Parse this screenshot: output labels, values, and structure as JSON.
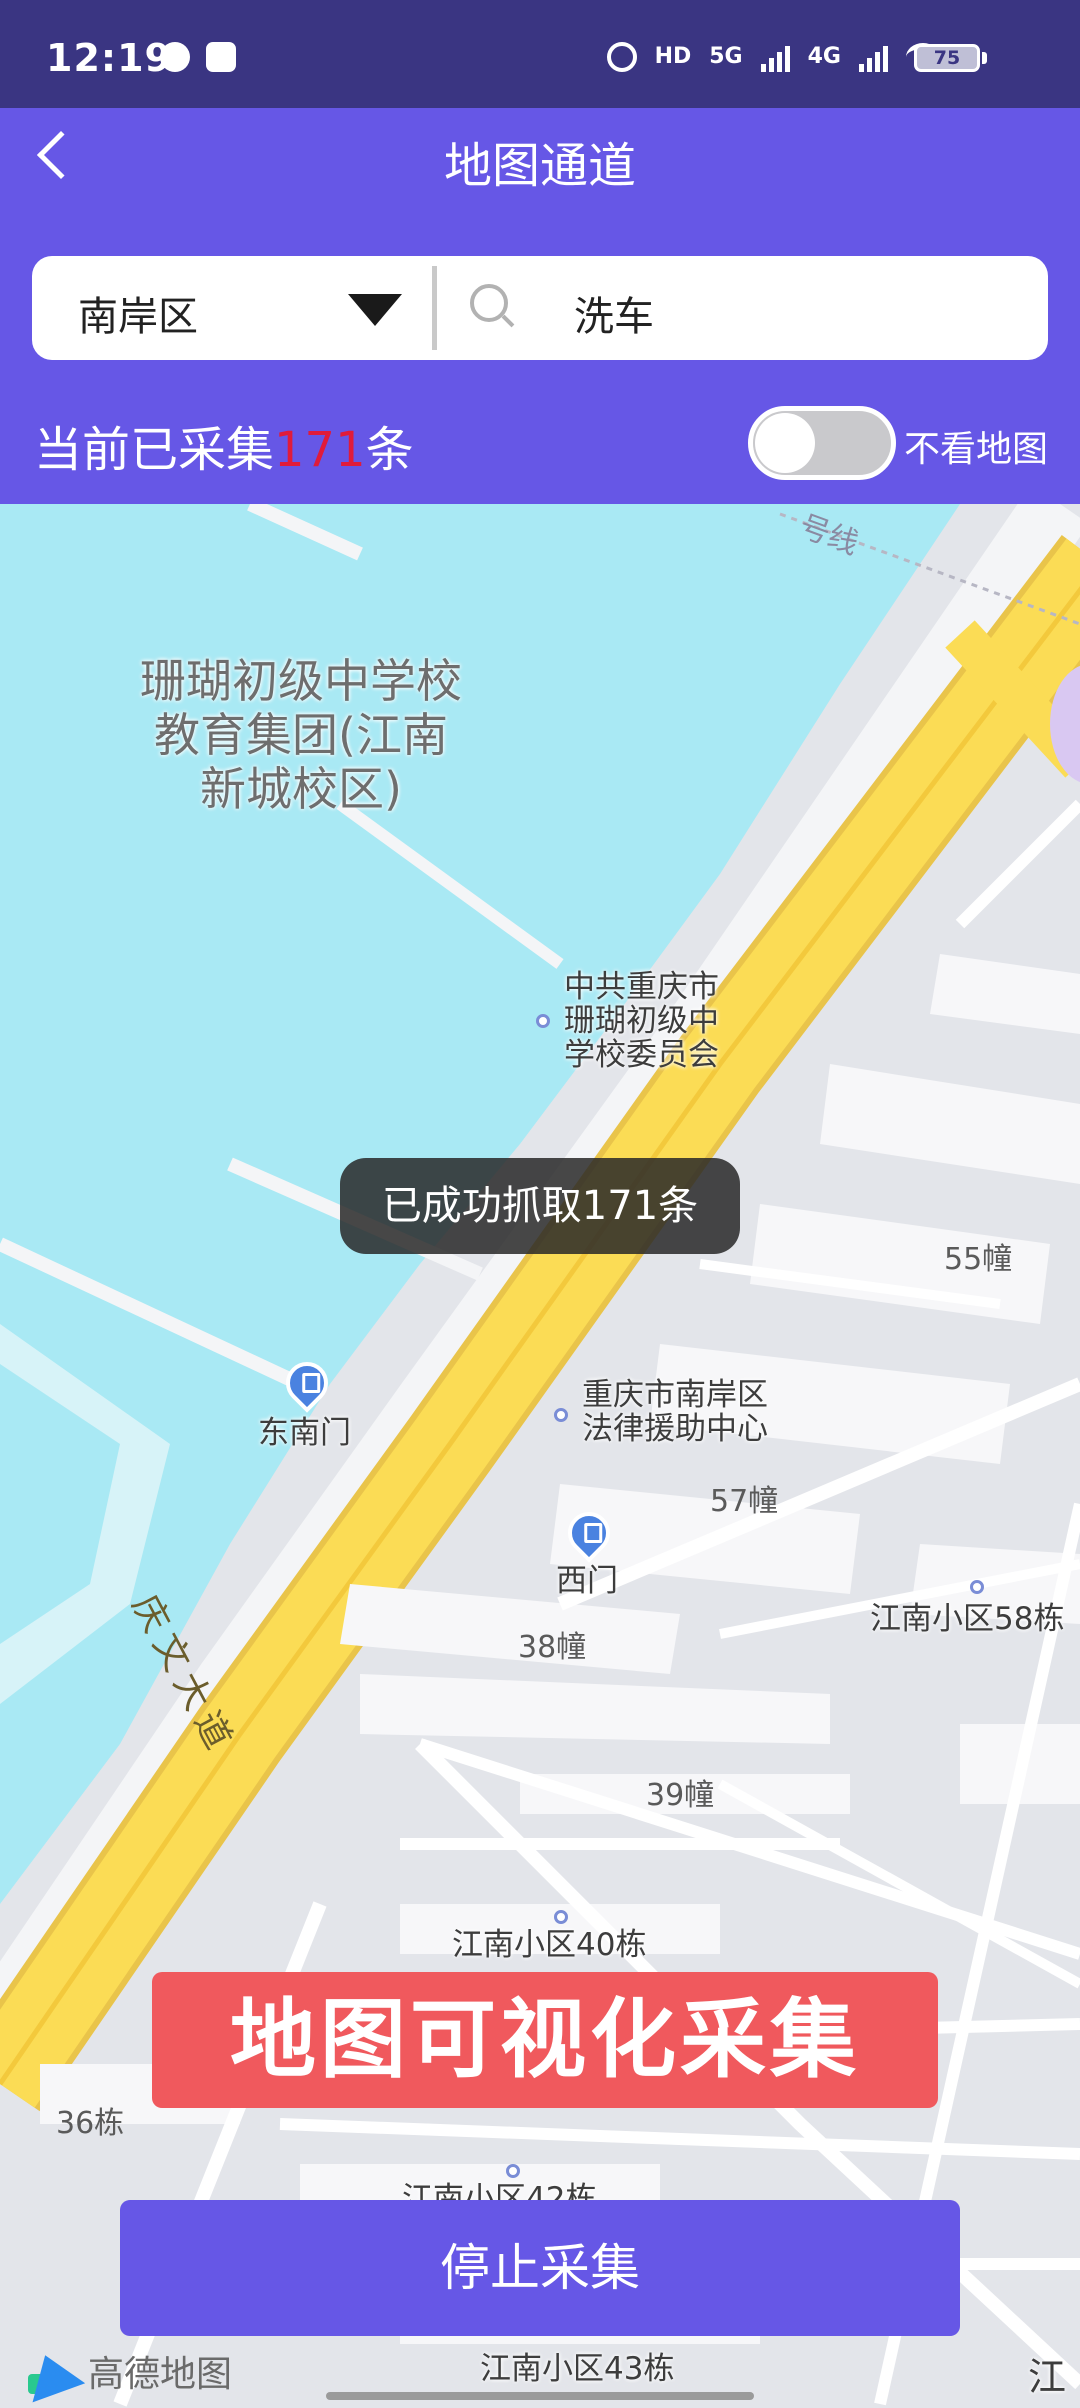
{
  "status_bar": {
    "time": "12:19",
    "hd_label": "HD",
    "net1": "5G",
    "net2": "4G",
    "battery": "75"
  },
  "header": {
    "title": "地图通道",
    "region": "南岸区",
    "keyword": "洗车",
    "collect_prefix": "当前已采集",
    "collect_count": "171",
    "collect_suffix": "条",
    "toggle_label": "不看地图",
    "colors": {
      "accent": "#6657e6",
      "count": "#e01b3a"
    }
  },
  "map": {
    "poi_school": "珊瑚初级中学校\n教育集团(江南\n新城校区)",
    "poi_committee": "中共重庆市\n珊瑚初级中\n学校委员会",
    "poi_legal": "重庆市南岸区\n法律援助中心",
    "gate_southeast": "东南门",
    "gate_west": "西门",
    "road_name": "庆文大道",
    "line_label": "号线",
    "bld_55": "55幢",
    "bld_57": "57幢",
    "bld_38": "38幢",
    "bld_39": "39幢",
    "bld_58": "江南小区58栋",
    "bld_40": "江南小区40栋",
    "bld_36": "36栋",
    "bld_42": "江南小区42栋",
    "bld_43": "江南小区43栋",
    "edge_label": "江"
  },
  "toast": "已成功抓取171条",
  "banner": "地图可视化采集",
  "stop_button": "停止采集",
  "map_logo": "高德地图"
}
